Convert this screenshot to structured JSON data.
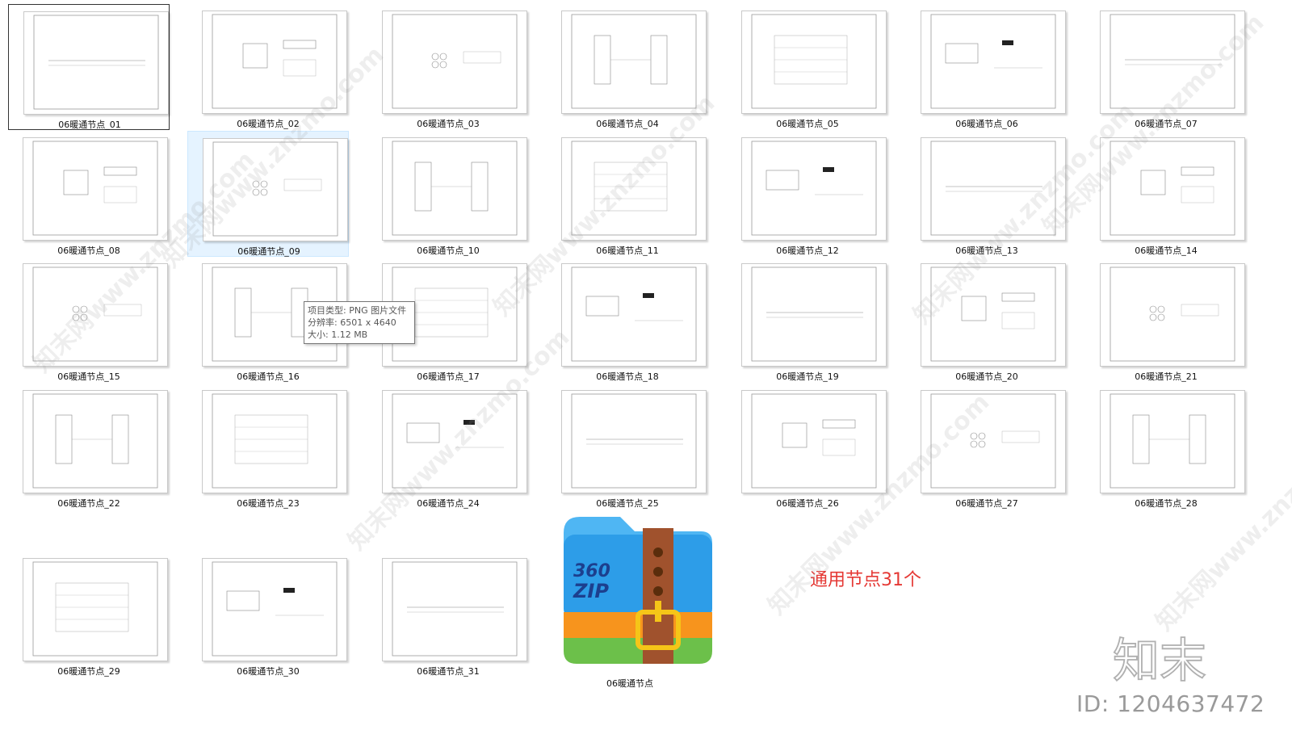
{
  "files": [
    {
      "name": "06暖通节点_01",
      "selected": true
    },
    {
      "name": "06暖通节点_02"
    },
    {
      "name": "06暖通节点_03"
    },
    {
      "name": "06暖通节点_04"
    },
    {
      "name": "06暖通节点_05"
    },
    {
      "name": "06暖通节点_06"
    },
    {
      "name": "06暖通节点_07"
    },
    {
      "name": "06暖通节点_08"
    },
    {
      "name": "06暖通节点_09",
      "hover": true
    },
    {
      "name": "06暖通节点_10"
    },
    {
      "name": "06暖通节点_11"
    },
    {
      "name": "06暖通节点_12"
    },
    {
      "name": "06暖通节点_13"
    },
    {
      "name": "06暖通节点_14"
    },
    {
      "name": "06暖通节点_15"
    },
    {
      "name": "06暖通节点_16"
    },
    {
      "name": "06暖通节点_17"
    },
    {
      "name": "06暖通节点_18"
    },
    {
      "name": "06暖通节点_19"
    },
    {
      "name": "06暖通节点_20"
    },
    {
      "name": "06暖通节点_21"
    },
    {
      "name": "06暖通节点_22"
    },
    {
      "name": "06暖通节点_23"
    },
    {
      "name": "06暖通节点_24"
    },
    {
      "name": "06暖通节点_25"
    },
    {
      "name": "06暖通节点_26"
    },
    {
      "name": "06暖通节点_27"
    },
    {
      "name": "06暖通节点_28"
    },
    {
      "name": "06暖通节点_29"
    },
    {
      "name": "06暖通节点_30"
    },
    {
      "name": "06暖通节点_31"
    }
  ],
  "archive": {
    "name": "06暖通节点",
    "icon": "360zip-archive-icon",
    "brand_top": "360",
    "brand_bottom": "ZIP"
  },
  "tooltip": {
    "type_line": "项目类型: PNG 图片文件",
    "resolution_line": "分辨率: 6501 x 4640",
    "size_line": "大小: 1.12 MB"
  },
  "note": "通用节点31个",
  "logo_text": "知末",
  "id_text": "ID: 1204637472",
  "watermark_text": "知末网www.znzmo.com",
  "colors": {
    "note": "#e53935",
    "selection_bg": "#e5f3ff",
    "id_text": "#9a9a9a"
  }
}
